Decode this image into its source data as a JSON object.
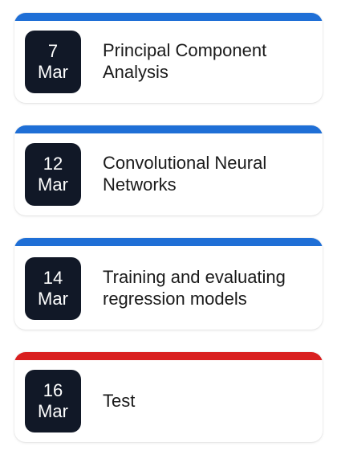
{
  "colors": {
    "accent_blue": "#1f6fd6",
    "accent_red": "#d91f1f",
    "badge_bg": "#111827",
    "text": "#1a1a1a"
  },
  "events": [
    {
      "day": "7",
      "month": "Mar",
      "title": "Principal Component Analysis",
      "accent": "blue"
    },
    {
      "day": "12",
      "month": "Mar",
      "title": "Convolutional Neural Networks",
      "accent": "blue"
    },
    {
      "day": "14",
      "month": "Mar",
      "title": "Training and evaluating regression models",
      "accent": "blue"
    },
    {
      "day": "16",
      "month": "Mar",
      "title": "Test",
      "accent": "red"
    }
  ]
}
